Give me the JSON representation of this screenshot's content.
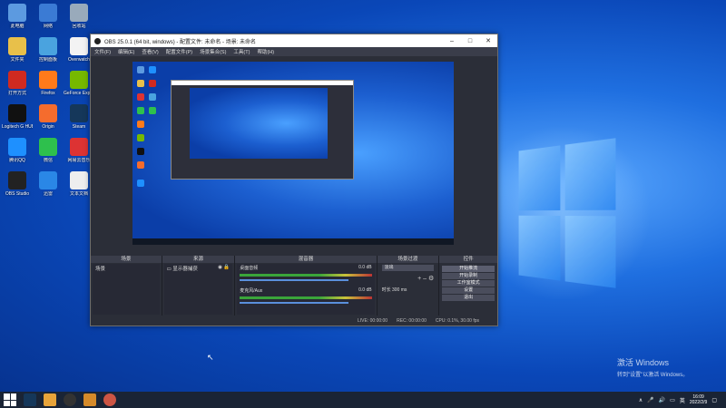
{
  "desktop": {
    "icons": [
      {
        "label": "此电脑",
        "color": "#5c9ae0"
      },
      {
        "label": "网络",
        "color": "#3b7bd4"
      },
      {
        "label": "回收站",
        "color": "#9ab"
      },
      {
        "label": "文件夹",
        "color": "#e8c04a"
      },
      {
        "label": "控制面板",
        "color": "#4aa3df"
      },
      {
        "label": "Overwatch",
        "color": "#f3f3f3"
      },
      {
        "label": "打开方式",
        "color": "#d02a20"
      },
      {
        "label": "Firefox",
        "color": "#ff7a1a"
      },
      {
        "label": "GeForce Experience",
        "color": "#76b900"
      },
      {
        "label": "Logitech G HUB",
        "color": "#111"
      },
      {
        "label": "Origin",
        "color": "#f56c2d"
      },
      {
        "label": "Steam",
        "color": "#15375a"
      },
      {
        "label": "腾讯QQ",
        "color": "#1e90ff"
      },
      {
        "label": "微信",
        "color": "#2ec04d"
      },
      {
        "label": "网易云音乐",
        "color": "#d33"
      },
      {
        "label": "OBS Studio",
        "color": "#222"
      },
      {
        "label": "迅雷",
        "color": "#2a87e6"
      },
      {
        "label": "文本文档",
        "color": "#eee"
      }
    ],
    "watermark_title": "激活 Windows",
    "watermark_sub": "转到\"设置\"以激活 Windows。"
  },
  "obs": {
    "title": "OBS 25.0.1 (64 bit, windows) - 配置文件: 未命名 - 场景: 未命名",
    "menu": [
      "文件(F)",
      "编辑(E)",
      "查看(V)",
      "配置文件(P)",
      "场景集合(S)",
      "工具(T)",
      "帮助(H)"
    ],
    "docks": {
      "scenes": {
        "title": "场景",
        "items": [
          "场景"
        ]
      },
      "sources": {
        "title": "来源",
        "items": [
          "显示器捕获"
        ]
      },
      "mixer": {
        "title": "混音器",
        "rows": [
          {
            "label": "桌面音频",
            "db": "0.0 dB"
          },
          {
            "label": "麦克风/Aux",
            "db": "0.0 dB"
          }
        ]
      },
      "transitions": {
        "title": "场景过渡",
        "type": "淡出",
        "duration_label": "时长",
        "duration": "300 ms"
      },
      "controls": {
        "title": "控件",
        "buttons": [
          "开始推流",
          "开始录制",
          "工作室模式",
          "设置",
          "退出"
        ]
      }
    },
    "status": {
      "live": "LIVE: 00:00:00",
      "rec": "REC: 00:00:00",
      "cpu": "CPU: 0.1%, 30.00 fps"
    }
  },
  "taskbar": {
    "time": "16:09",
    "date": "2022/2/9"
  }
}
